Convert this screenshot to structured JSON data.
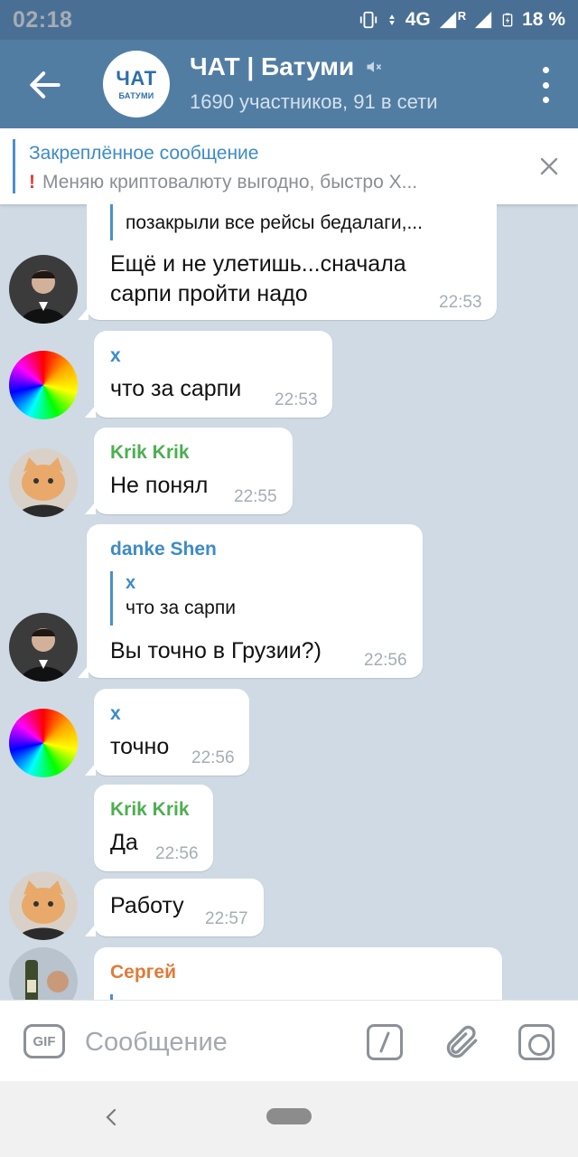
{
  "status_bar": {
    "time": "02:18",
    "network": "4G",
    "roaming": "R",
    "battery": "18 %"
  },
  "header": {
    "avatar_text": "ЧАТ",
    "avatar_subtext": "БАТУМИ",
    "title": "ЧАТ | Батуми",
    "subtitle": "1690 участников, 91 в сети",
    "muted": true
  },
  "pinned": {
    "title": "Закреплённое сообщение",
    "text": "Меняю криптовалюту выгодно, быстро  Х..."
  },
  "messages": [
    {
      "quote_text": "позакрыли все рейсы бедалаги,...",
      "lines": [
        "Ещё и не улетишь...сначала",
        "сарпи пройти надо"
      ],
      "time": "22:53",
      "avatar": "man-avatar"
    },
    {
      "sender": "x",
      "lines": [
        "что за сарпи"
      ],
      "time": "22:53",
      "avatar": "color-wheel-avatar"
    },
    {
      "sender": "Krik Krik",
      "lines": [
        "Не понял"
      ],
      "time": "22:55",
      "avatar": "cat-avatar"
    },
    {
      "sender": "danke Shen",
      "quote_name": "x",
      "quote_text": "что за сарпи",
      "lines": [
        "Вы точно в Грузии?)"
      ],
      "time": "22:56",
      "avatar": "man-avatar"
    },
    {
      "sender": "x",
      "lines": [
        "точно"
      ],
      "time": "22:56",
      "avatar": "color-wheel-avatar"
    },
    {
      "sender": "Krik Krik",
      "lines": [
        "Да"
      ],
      "time": "22:56",
      "avatar": "cat-avatar"
    },
    {
      "lines": [
        "Работу"
      ],
      "time": "22:57",
      "avatar": "cat-avatar"
    },
    {
      "sender": "Сергей",
      "avatar": "wine-avatar"
    }
  ],
  "input": {
    "gif_label": "GIF",
    "placeholder": "Сообщение"
  },
  "colors": {
    "header_bg": "#527da3",
    "status_bg": "#4a6f94",
    "chat_bg": "#cfdae4",
    "accent_blue": "#3d8bc7",
    "name_green": "#4caf50",
    "name_orange": "#e07b39"
  }
}
